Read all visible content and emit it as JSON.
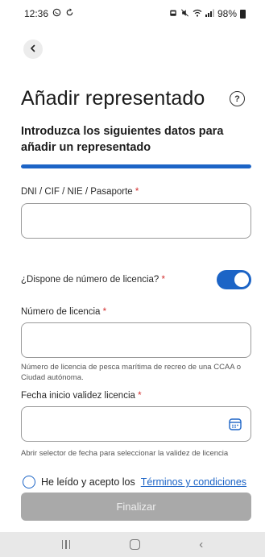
{
  "status_bar": {
    "time": "12:36",
    "left_icons": [
      "whatsapp-icon",
      "sync-icon"
    ],
    "right_icons": [
      "alarm-icon",
      "mute-icon",
      "wifi-icon",
      "signal-icon"
    ],
    "battery": "98%"
  },
  "header": {
    "back_icon": "chevron-left-icon",
    "title": "Añadir representado",
    "help_icon": "question-circle-icon"
  },
  "subtitle": "Introduzca los siguientes datos para añadir un representado",
  "progress": {
    "fraction": 1.0,
    "color": "#1c64c6"
  },
  "form": {
    "id_field": {
      "label": "DNI / CIF / NIE / Pasaporte",
      "required_mark": "*",
      "value": ""
    },
    "license_toggle": {
      "label": "¿Dispone de número de licencia?",
      "required_mark": "*",
      "checked": true
    },
    "license_number": {
      "label": "Número de licencia",
      "required_mark": "*",
      "value": "",
      "helper": "Número de licencia de pesca marítima de recreo de una CCAA o Ciudad autónoma."
    },
    "start_date": {
      "label": "Fecha inicio validez licencia",
      "required_mark": "*",
      "value": "",
      "helper": "Abrir selector de fecha para seleccionar la validez de licencia",
      "icon": "calendar-icon"
    },
    "terms": {
      "text": "He leído y acepto los",
      "link": "Términos y condiciones",
      "checked": false
    },
    "submit_label": "Finalizar"
  },
  "colors": {
    "accent": "#1c64c6",
    "required": "#d32f2f",
    "disabled_button": "#a9a9a9"
  },
  "nav_bar": {
    "icons": [
      "recent-apps-icon",
      "home-icon",
      "back-icon"
    ]
  }
}
